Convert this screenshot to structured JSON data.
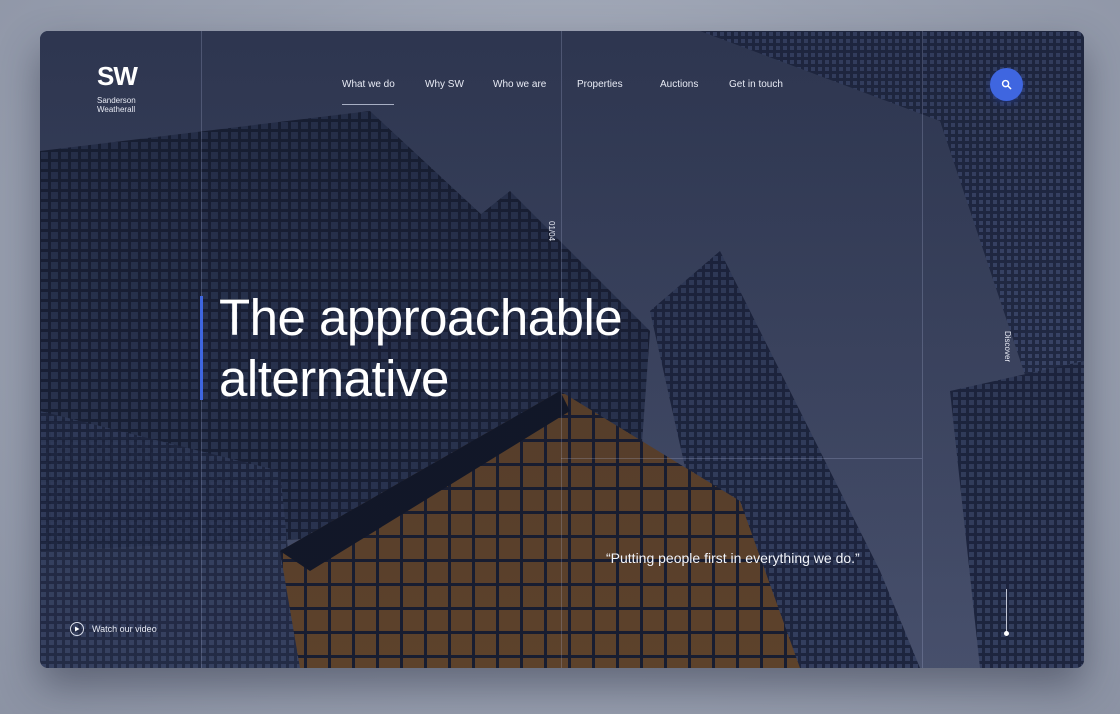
{
  "brand": {
    "mark": "SW",
    "name_line1": "Sanderson",
    "name_line2": "Weatherall"
  },
  "nav": {
    "items": [
      {
        "label": "What we do",
        "active": true
      },
      {
        "label": "Why SW"
      },
      {
        "label": "Who we are"
      },
      {
        "label": "Properties"
      },
      {
        "label": "Auctions"
      },
      {
        "label": "Get in touch"
      }
    ]
  },
  "search": {
    "icon": "search-icon"
  },
  "slide_counter": "01/04",
  "hero": {
    "title_line1": "The approachable",
    "title_line2": "alternative"
  },
  "quote": "“Putting people first in everything we do.”",
  "video": {
    "label": "Watch our video",
    "icon": "play-icon"
  },
  "discover": "Discover",
  "colors": {
    "accent": "#3f66e0",
    "background_dark": "#1e2540",
    "page_bg": "#9aa1b1"
  }
}
